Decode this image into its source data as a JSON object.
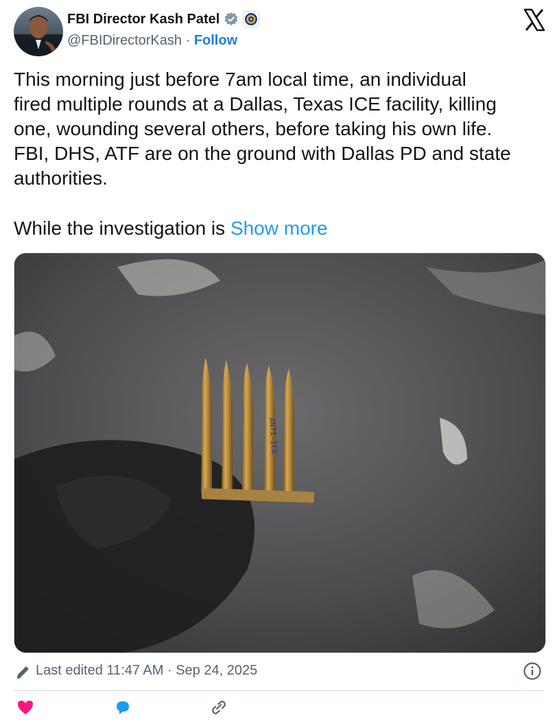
{
  "author": {
    "name": "FBI Director Kash Patel",
    "handle": "@FBIDirectorKash",
    "separator": "·",
    "follow_label": "Follow"
  },
  "icons": {
    "verified": "verified-badge-icon",
    "affiliation": "fbi-seal-icon",
    "platform": "x-logo-icon",
    "edit": "pencil-icon",
    "info": "info-icon"
  },
  "post": {
    "text": "This morning just before 7am local time, an individual\nfired multiple rounds at a Dallas, Texas ICE facility, killing\none, wounding several others, before taking his own life.\nFBI, DHS, ATF are on the ground with Dallas PD and state\nauthorities.",
    "truncated_text": "While the investigation is ",
    "show_more_label": "Show more"
  },
  "meta": {
    "edited_label": "Last edited 11:47 AM · Sep 24, 2025"
  },
  "colors": {
    "link": "#1d9bf0",
    "follow": "#1d7fd4",
    "secondary_text": "#536471",
    "verified": "#829aab"
  }
}
